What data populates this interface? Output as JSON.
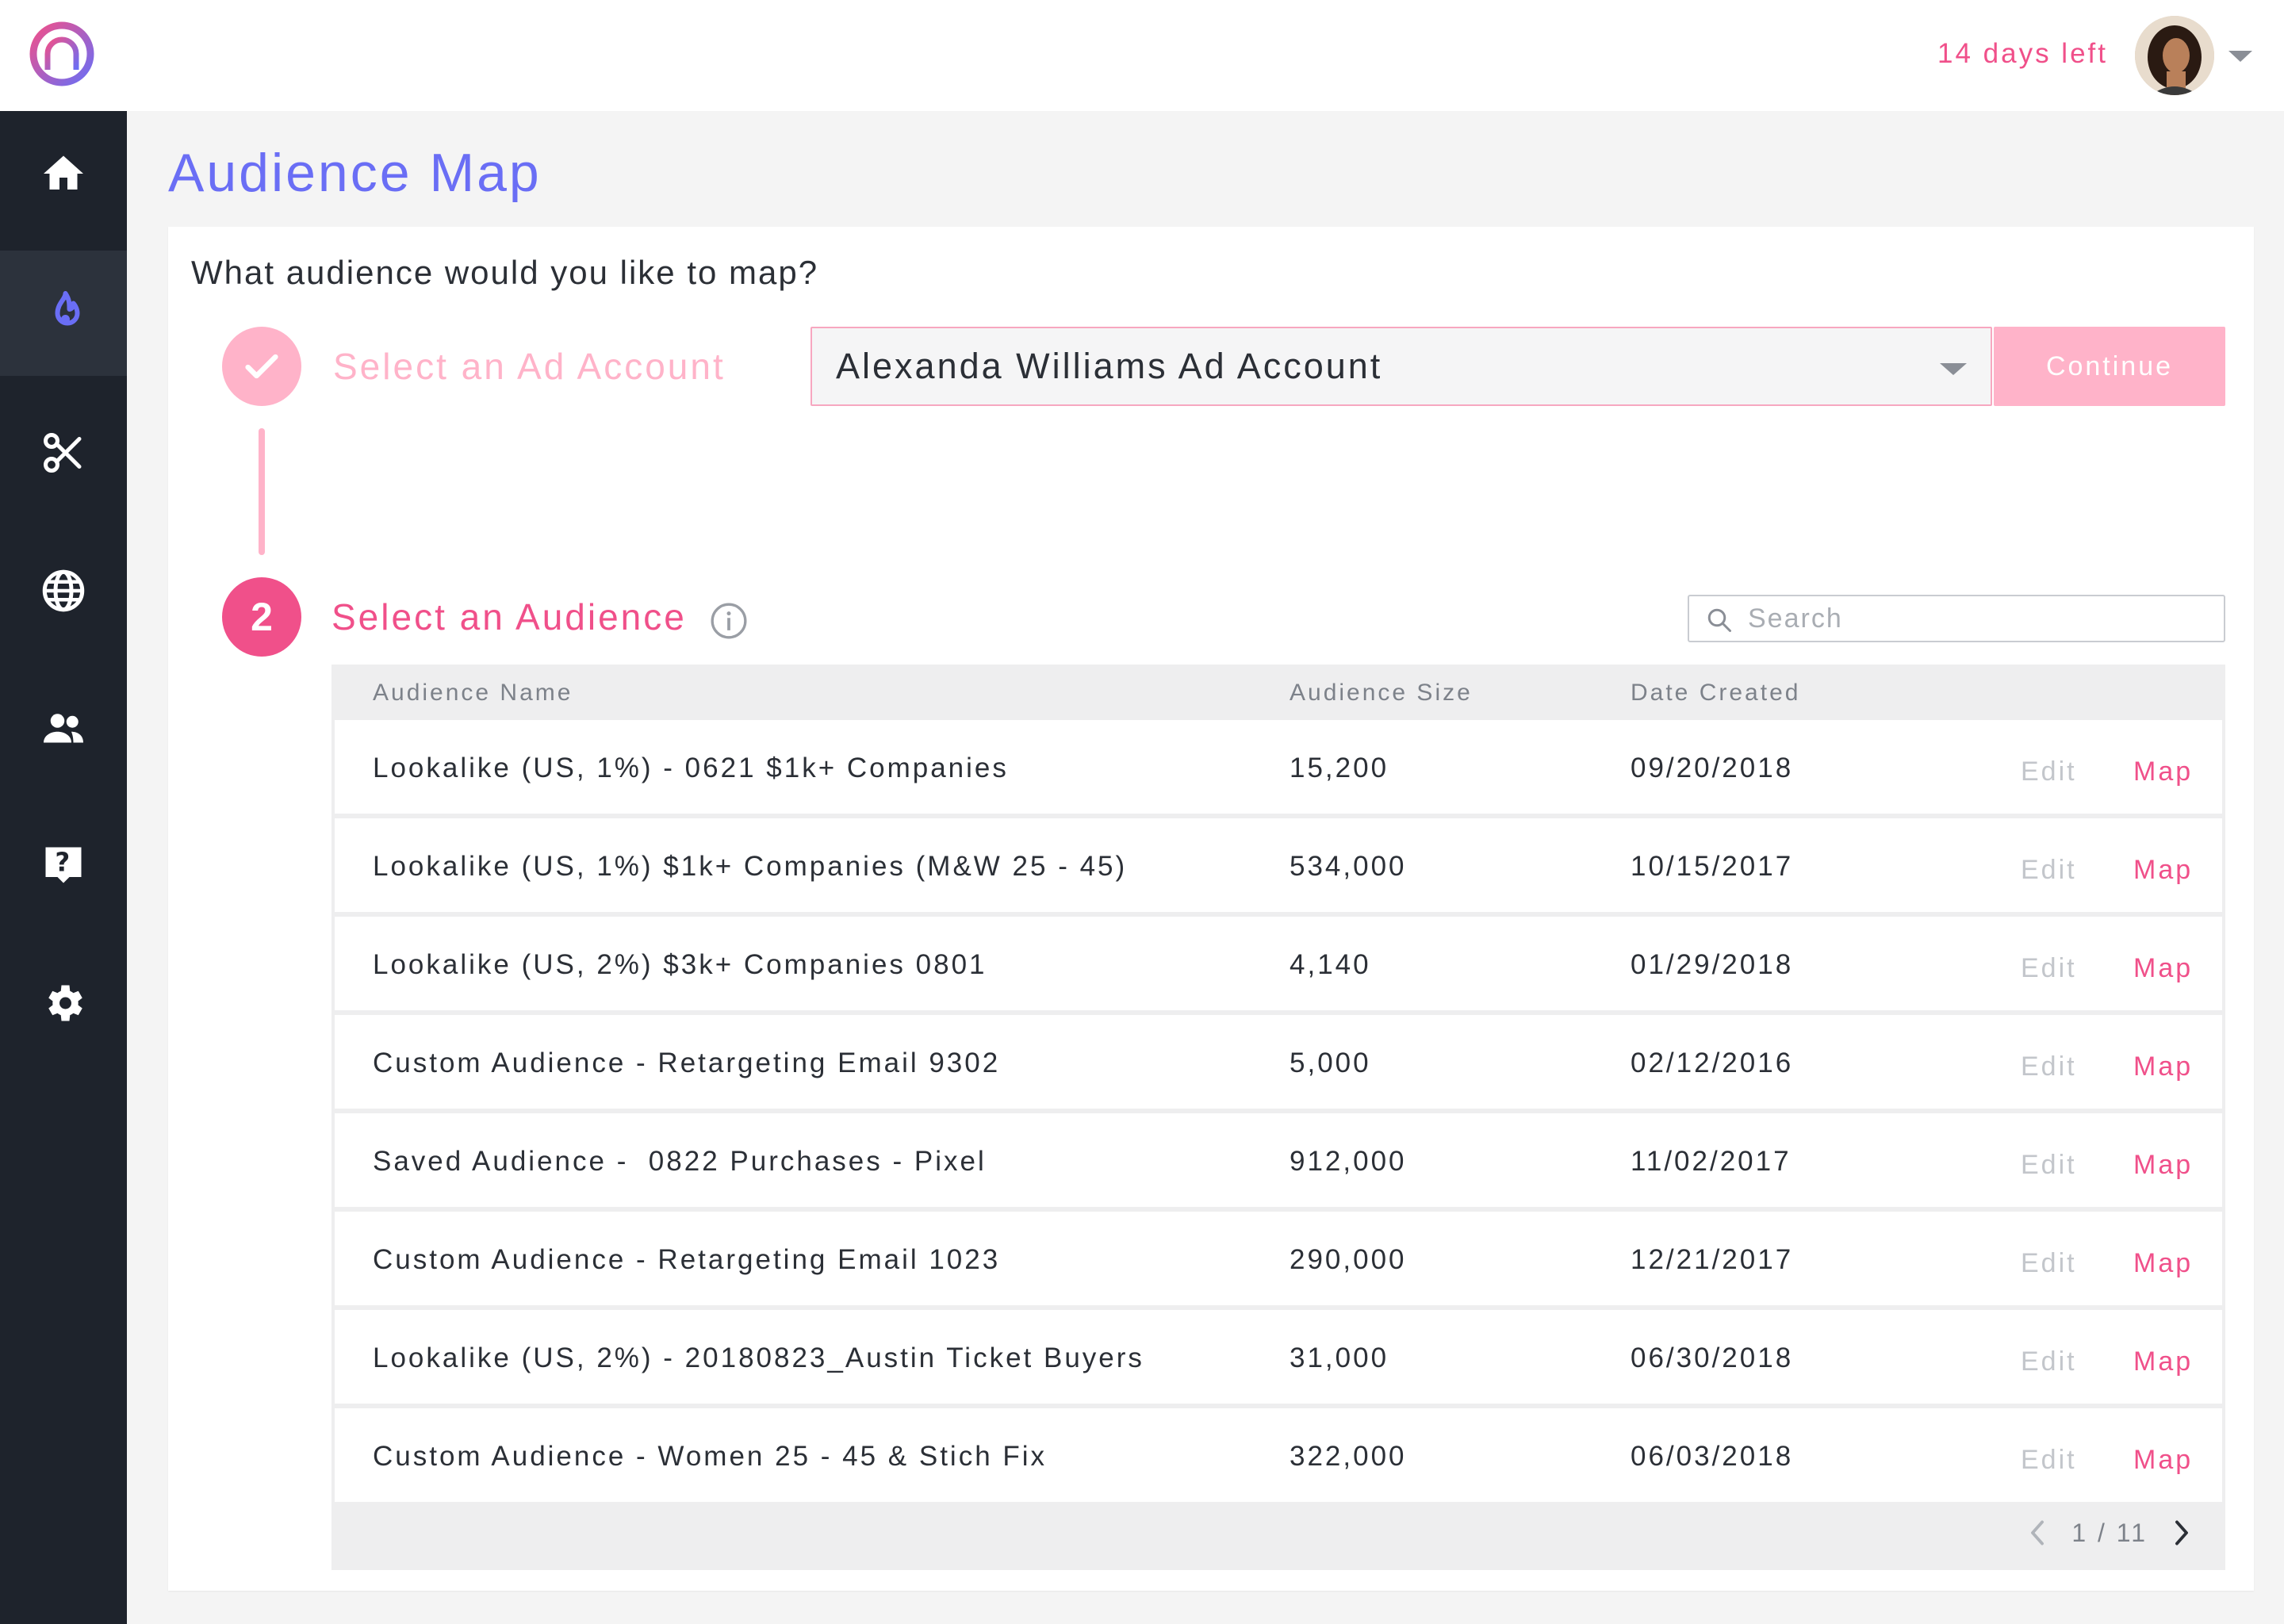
{
  "header": {
    "trial_text": "14 days left",
    "brand_color": "#f0508a",
    "accent_color": "#6a6ef5"
  },
  "sidebar": {
    "items": [
      {
        "name": "home",
        "icon": "home-icon",
        "active": false
      },
      {
        "name": "audience",
        "icon": "flame-icon",
        "active": true
      },
      {
        "name": "tools",
        "icon": "scissors-icon",
        "active": false
      },
      {
        "name": "web",
        "icon": "globe-icon",
        "active": false
      },
      {
        "name": "people",
        "icon": "people-icon",
        "active": false
      },
      {
        "name": "help",
        "icon": "help-icon",
        "active": false
      },
      {
        "name": "settings",
        "icon": "gear-icon",
        "active": false
      }
    ]
  },
  "page": {
    "title": "Audience Map",
    "question": "What audience would you like to map?"
  },
  "step1": {
    "label": "Select an Ad Account",
    "selected_account": "Alexanda Williams Ad Account",
    "continue_label": "Continue"
  },
  "step2": {
    "number": "2",
    "label": "Select an Audience",
    "search_placeholder": "Search"
  },
  "table": {
    "columns": [
      "Audience Name",
      "Audience Size",
      "Date Created"
    ],
    "edit_label": "Edit",
    "map_label": "Map",
    "rows": [
      {
        "name": "Lookalike (US, 1%) - 0621 $1k+ Companies",
        "size": "15,200",
        "date": "09/20/2018"
      },
      {
        "name": "Lookalike (US, 1%) $1k+ Companies (M&W 25 - 45)",
        "size": "534,000",
        "date": "10/15/2017"
      },
      {
        "name": "Lookalike (US, 2%) $3k+ Companies 0801",
        "size": "4,140",
        "date": "01/29/2018"
      },
      {
        "name": "Custom Audience - Retargeting Email 9302",
        "size": "5,000",
        "date": "02/12/2016"
      },
      {
        "name": "Saved Audience -  0822 Purchases - Pixel",
        "size": "912,000",
        "date": "11/02/2017"
      },
      {
        "name": "Custom Audience - Retargeting Email 1023",
        "size": "290,000",
        "date": "12/21/2017"
      },
      {
        "name": "Lookalike (US, 2%) - 20180823_Austin Ticket Buyers",
        "size": "31,000",
        "date": "06/30/2018"
      },
      {
        "name": "Custom Audience - Women 25 - 45 & Stich Fix",
        "size": "322,000",
        "date": "06/03/2018"
      }
    ],
    "pagination": "1 / 11"
  }
}
